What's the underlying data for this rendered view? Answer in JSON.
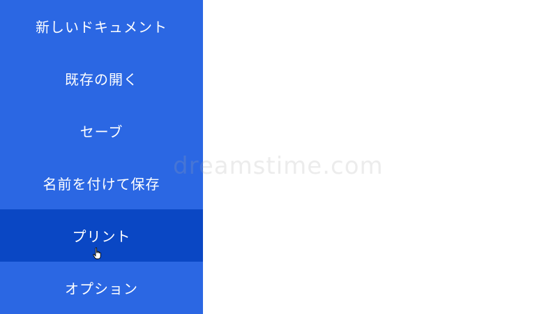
{
  "colors": {
    "sidebar_bg": "#2b67e3",
    "active_bg": "#0a47c4",
    "text": "#ffffff",
    "content_bg": "#ffffff"
  },
  "menu": {
    "items": [
      {
        "label": "新しいドキュメント"
      },
      {
        "label": "既存の開く"
      },
      {
        "label": "セーブ"
      },
      {
        "label": "名前を付けて保存"
      },
      {
        "label": "プリント",
        "active": true
      },
      {
        "label": "オプション"
      }
    ]
  },
  "cursor_icon": "hand-pointer-icon",
  "watermark": {
    "text": "dreamstime.com"
  }
}
